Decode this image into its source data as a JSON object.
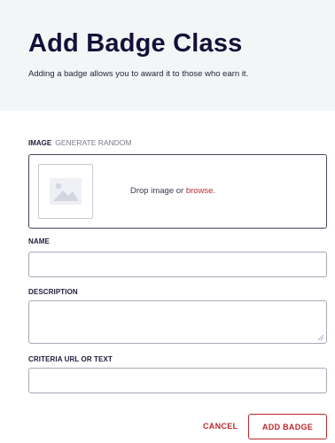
{
  "header": {
    "title": "Add Badge Class",
    "subtitle": "Adding a badge allows you to award it to those who earn it."
  },
  "image_field": {
    "label": "IMAGE",
    "generate_link": "GENERATE RANDOM",
    "drop_text": "Drop image or ",
    "browse_link": "browse.",
    "placeholder_icon": "image-placeholder-icon"
  },
  "name_field": {
    "label": "NAME",
    "value": ""
  },
  "description_field": {
    "label": "DESCRIPTION",
    "value": ""
  },
  "criteria_field": {
    "label": "CRITERIA URL OR TEXT",
    "value": ""
  },
  "actions": {
    "cancel_label": "CANCEL",
    "submit_label": "ADD BADGE"
  },
  "colors": {
    "accent": "#c0272d",
    "header_bg": "#f4f5f7",
    "title": "#121238"
  }
}
